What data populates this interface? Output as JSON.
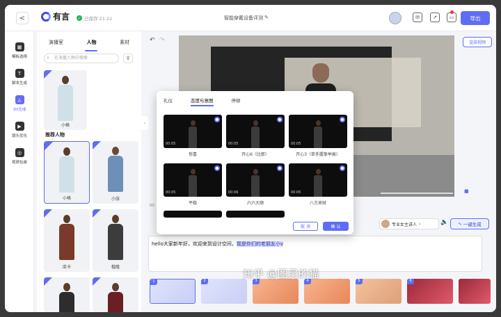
{
  "topbar": {
    "back": "<",
    "brand": "有言",
    "saved": "已保存 21:22",
    "doc_title": "智能穿戴设备评测",
    "edit_icon": "✎",
    "export": "导出"
  },
  "sidenav": [
    {
      "label": "模板选择",
      "icon": "grid-icon"
    },
    {
      "label": "脚本生成",
      "icon": "text-icon"
    },
    {
      "label": "3D生成",
      "icon": "chart-icon"
    },
    {
      "label": "镜头优化",
      "icon": "camera-icon"
    },
    {
      "label": "视频包装",
      "icon": "film-icon"
    }
  ],
  "library": {
    "tabs": [
      "演播室",
      "人物",
      "素材"
    ],
    "active_tab": "人物",
    "search_placeholder": "在海量人物中搜索",
    "section_title": "推荐人物",
    "top_card": "小格",
    "cards": [
      "小格",
      "小张",
      "库卡",
      "楷隆",
      "",
      ""
    ]
  },
  "editor": {
    "render_button": "渲染视频",
    "voice": "专业女主讲人",
    "voice_chevron": "›",
    "generate": "一键生成",
    "script_plain": "hello大家新年好，欢迎来到设计空间，",
    "script_highlight": "我是你们的老朋友小v",
    "duration_prefix": "00"
  },
  "modal": {
    "tabs": [
      "礼仪",
      "态度与意图",
      "停顿"
    ],
    "active_tab": "态度与意图",
    "poses": [
      {
        "label": "惊喜",
        "time": "00:05"
      },
      {
        "label": "开心6（比耶）",
        "time": "00:05"
      },
      {
        "label": "开心3（单手握拳举高）",
        "time": "00:05"
      },
      {
        "label": "平稳",
        "time": "00:05"
      },
      {
        "label": "六六大顺",
        "time": "00:06"
      },
      {
        "label": "八方来财",
        "time": "00:05"
      }
    ],
    "cancel": "取 消",
    "ok": "确 认"
  },
  "watermark": "知乎 @图灵的猫",
  "colors": {
    "accent": "#5f6df5",
    "saved": "#21b25b"
  }
}
